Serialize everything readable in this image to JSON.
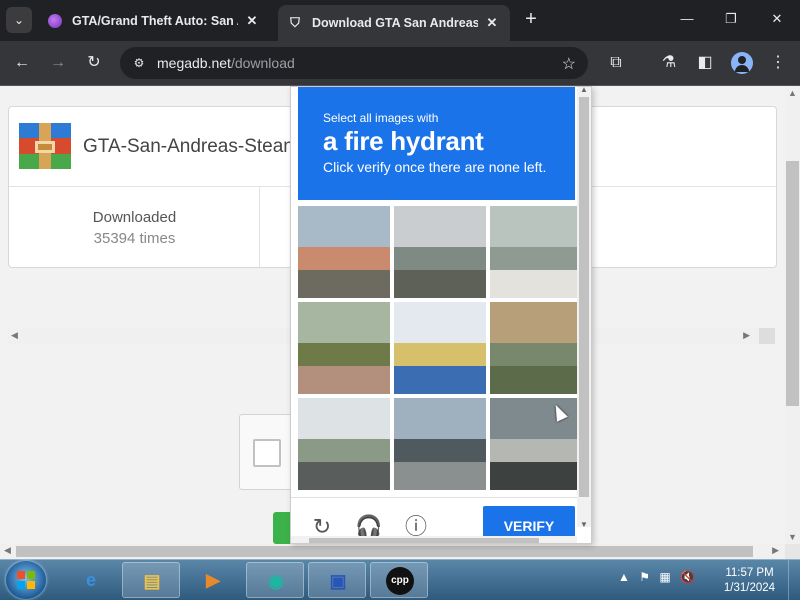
{
  "browser": {
    "tabs": [
      {
        "title": "GTA/Grand Theft Auto: San Andreas",
        "active": false,
        "close": "✕"
      },
      {
        "title": "Download GTA San Andreas Steam",
        "active": true,
        "close": "✕"
      }
    ],
    "new_tab": "+",
    "window_controls": {
      "minimize": "—",
      "restore": "❐",
      "close": "✕"
    },
    "toolbar": {
      "back": "←",
      "forward": "→",
      "reload": "↻",
      "url_host": "megadb.net",
      "url_path": "/download",
      "star": "☆",
      "extensions": "⧉",
      "labs": "⚗",
      "sidepanel": "◧",
      "menu": "⋮"
    }
  },
  "page": {
    "file_name": "GTA-San-Andreas-SteamRip",
    "stats": [
      {
        "label": "Downloaded",
        "value": "35394 times"
      }
    ]
  },
  "captcha": {
    "instruction_small": "Select all images with",
    "instruction_target": "a fire hydrant",
    "instruction_sub": "Click verify once there are none left.",
    "tiles": [
      {
        "desc": "street-buildings",
        "colors": [
          "#a8b9c8",
          "#c98a6e",
          "#6d6a5f"
        ]
      },
      {
        "desc": "highway-overpass",
        "colors": [
          "#c9cdd0",
          "#7f8a84",
          "#5d6158"
        ]
      },
      {
        "desc": "pole-wires",
        "colors": [
          "#b9c4bf",
          "#8f9a92",
          "#e4e2dc"
        ]
      },
      {
        "desc": "sidewalk-fence",
        "colors": [
          "#a7b6a0",
          "#6e7a48",
          "#b38f7d"
        ]
      },
      {
        "desc": "shop-awning",
        "colors": [
          "#e4e9ef",
          "#d6c06c",
          "#3b6db3"
        ]
      },
      {
        "desc": "roof-structure",
        "colors": [
          "#b79f7a",
          "#78886d",
          "#5c6b4a"
        ]
      },
      {
        "desc": "sign-gantry",
        "colors": [
          "#dde2e4",
          "#8a9a86",
          "#595e5c"
        ]
      },
      {
        "desc": "parking-lot",
        "colors": [
          "#9fb0bf",
          "#4e5a5d",
          "#8a8f90"
        ]
      },
      {
        "desc": "fire-hydrant",
        "colors": [
          "#7e8a8e",
          "#b5b7b3",
          "#3d4140"
        ]
      }
    ],
    "verify_label": "VERIFY",
    "footer_icons": [
      "reload-icon",
      "audio-icon",
      "info-icon"
    ]
  },
  "taskbar": {
    "apps": [
      {
        "name": "ie",
        "glyph": "e",
        "color": "#3b8fe0",
        "active": false
      },
      {
        "name": "explorer",
        "glyph": "▤",
        "color": "#f0c24a",
        "active": true
      },
      {
        "name": "media",
        "glyph": "▶",
        "color": "#e88a2c",
        "active": false
      },
      {
        "name": "browser",
        "glyph": "◉",
        "color": "#1bb7a3",
        "active": true
      },
      {
        "name": "monitor",
        "glyph": "▣",
        "color": "#2a55b8",
        "active": true
      },
      {
        "name": "cppshot",
        "glyph": "cpp",
        "color": "#ffffff",
        "active": true
      }
    ],
    "tray_icons": [
      "▲",
      "⚑",
      "▦",
      "🔇"
    ],
    "time": "11:57 PM",
    "date": "1/31/2024"
  }
}
